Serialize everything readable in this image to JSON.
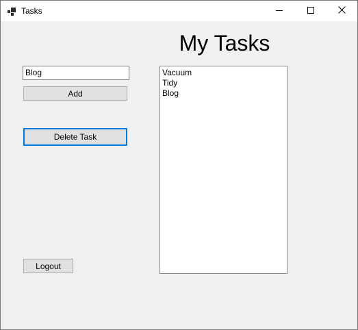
{
  "window": {
    "title": "Tasks",
    "app_icon": "app-window-icon",
    "caption_buttons": {
      "minimize_icon": "minimize-icon",
      "maximize_icon": "maximize-icon",
      "close_icon": "close-icon"
    }
  },
  "main": {
    "heading": "My Tasks",
    "task_input": {
      "value": "Blog",
      "placeholder": ""
    },
    "add_label": "Add",
    "delete_label": "Delete Task",
    "logout_label": "Logout",
    "tasks": [
      "Vacuum",
      "Tidy",
      "Blog"
    ]
  },
  "colors": {
    "window_bg": "#f0f0f0",
    "focus_border": "#0078d7",
    "button_bg": "#e1e1e1"
  }
}
